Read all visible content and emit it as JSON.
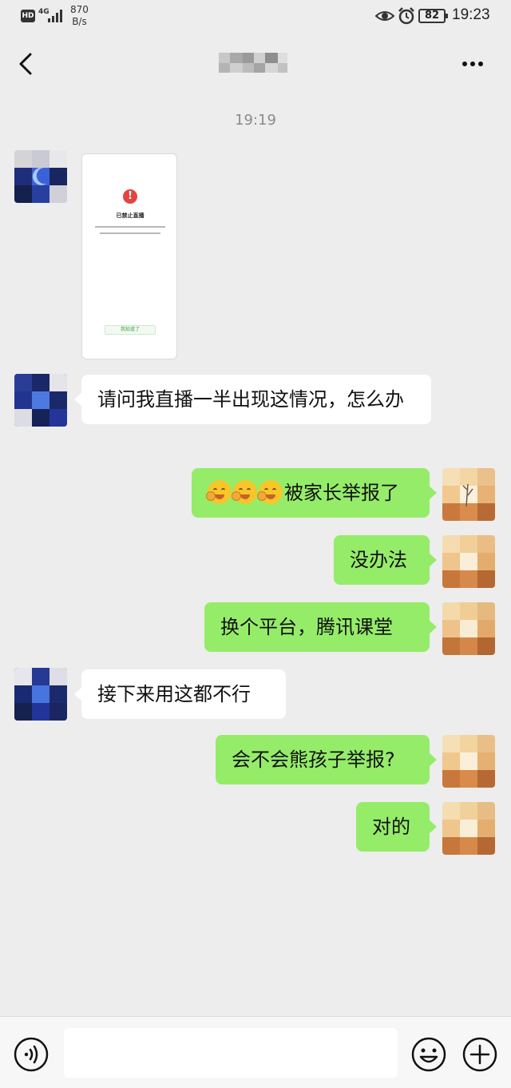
{
  "status_bar": {
    "hd": "HD",
    "network": "4G",
    "speed_value": "870",
    "speed_unit": "B/s",
    "battery": "82",
    "time": "19:23"
  },
  "nav": {
    "back_icon": "chevron-left-icon",
    "more_icon": "more-dots-icon"
  },
  "chat": {
    "timestamp": "19:19",
    "image_message": {
      "title": "已禁止直播",
      "button": "我知道了"
    },
    "messages": [
      {
        "side": "left",
        "text": "请问我直播一半出现这情况，怎么办"
      },
      {
        "side": "right",
        "emoji_count": 3,
        "emoji_name": "facepalm-laugh-emoji",
        "text": "被家长举报了"
      },
      {
        "side": "right",
        "text": "没办法"
      },
      {
        "side": "right",
        "text": "换个平台，腾讯课堂"
      },
      {
        "side": "left",
        "text": "接下来用这都不行"
      },
      {
        "side": "right",
        "text": "会不会熊孩子举报?"
      },
      {
        "side": "right",
        "text": "对的"
      }
    ]
  },
  "input_bar": {
    "voice_icon": "voice-icon",
    "emoji_icon": "emoji-icon",
    "plus_icon": "plus-icon"
  },
  "colors": {
    "background": "#ededed",
    "bubble_right": "#95ec69",
    "bubble_left": "#ffffff"
  }
}
